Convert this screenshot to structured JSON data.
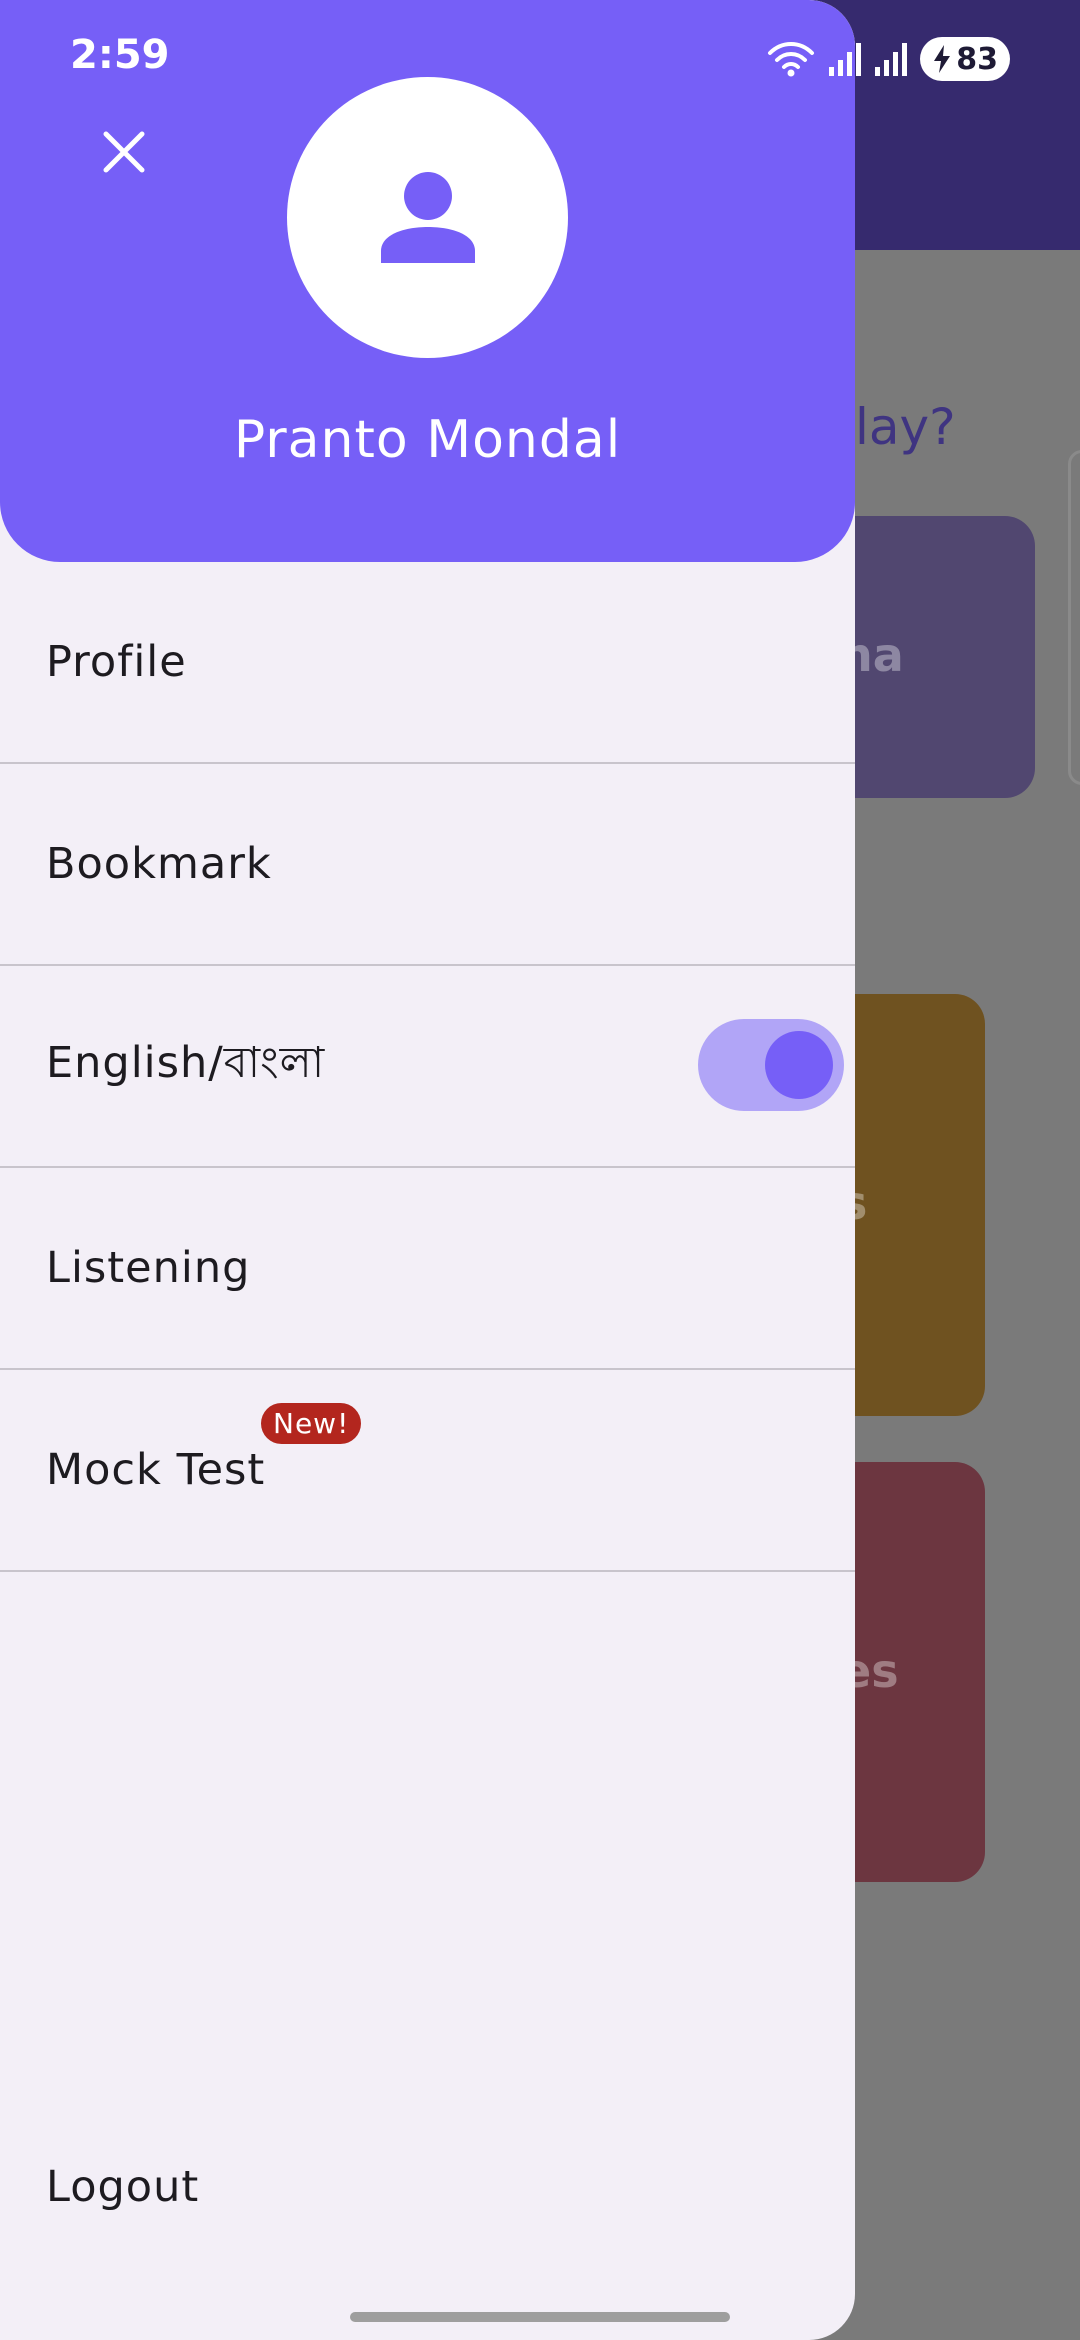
{
  "status_bar": {
    "time": "2:59",
    "battery_level": "83",
    "icons": [
      "wifi-icon",
      "signal-icon",
      "signal-icon",
      "charging-icon"
    ]
  },
  "drawer": {
    "user_name": "Pranto Mondal",
    "avatar_icon": "person-icon",
    "close_icon": "close-icon",
    "menu": {
      "profile": "Profile",
      "bookmark": "Bookmark",
      "language": "English/বাংলা",
      "listening": "Listening",
      "mock_test": "Mock Test",
      "mock_test_badge": "New!"
    },
    "language_toggle_on": true,
    "logout": "Logout"
  },
  "background": {
    "question_fragment": "lay?",
    "card_1_fragment": "na",
    "card_2_fragment": "s",
    "card_3_fragment": "es"
  },
  "colors": {
    "primary": "#765ff7",
    "drawer_bg": "#f3eff7",
    "badge": "#b3261e",
    "toggle_track": "#b1a5f7"
  }
}
